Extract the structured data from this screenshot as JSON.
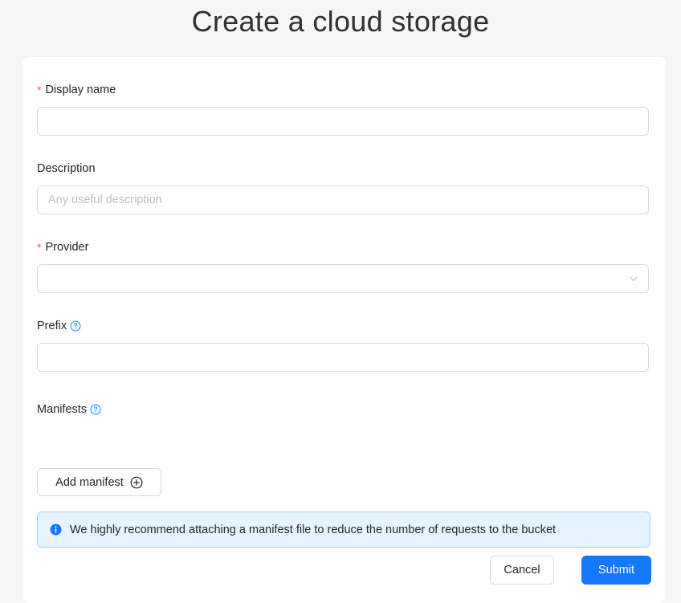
{
  "page": {
    "title": "Create a cloud storage"
  },
  "form": {
    "display_name": {
      "label": "Display name",
      "required_mark": "*",
      "value": "",
      "placeholder": ""
    },
    "description": {
      "label": "Description",
      "value": "",
      "placeholder": "Any useful description"
    },
    "provider": {
      "label": "Provider",
      "required_mark": "*",
      "selected": "",
      "icon": "chevron-down-icon"
    },
    "prefix": {
      "label": "Prefix",
      "value": "",
      "help_icon": "question-circle-icon"
    },
    "manifests": {
      "label": "Manifests",
      "help_icon": "question-circle-icon",
      "add_button_label": "Add manifest",
      "add_icon": "plus-circle-icon"
    }
  },
  "alert": {
    "type": "info",
    "icon": "info-circle-icon",
    "text": "We highly recommend attaching a manifest file to reduce the number of requests to the bucket"
  },
  "actions": {
    "cancel_label": "Cancel",
    "submit_label": "Submit"
  },
  "colors": {
    "primary": "#1677ff",
    "required": "#ff4d4f",
    "help": "#1890ff",
    "alert_bg": "#e6f4ff",
    "alert_border": "#a6d4fa"
  }
}
